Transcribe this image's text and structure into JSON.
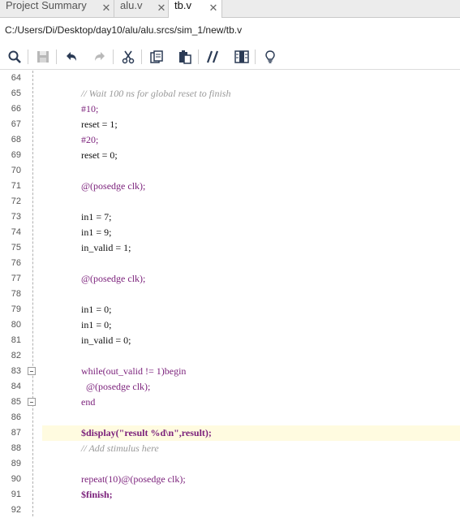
{
  "tabs": [
    {
      "label": "Project Summary",
      "active": false
    },
    {
      "label": "alu.v",
      "active": false
    },
    {
      "label": "tb.v",
      "active": true
    }
  ],
  "close_glyph": "✕",
  "file_path": "C:/Users/Di/Desktop/day10/alu/alu.srcs/sim_1/new/tb.v",
  "toolbar": {
    "icons": [
      "search-icon",
      "save-icon",
      "undo-icon",
      "redo-icon",
      "cut-icon",
      "copy-icon",
      "paste-icon",
      "comment-toggle-icon",
      "columns-icon",
      "lightbulb-icon"
    ]
  },
  "colors": {
    "keyword": "#7a1f7a",
    "comment": "#999999",
    "highlight": "#fffbe0"
  },
  "editor": {
    "highlighted_line": "87",
    "lines": [
      {
        "num": "64",
        "text": ""
      },
      {
        "num": "65",
        "text": "// Wait 100 ns for global reset to finish"
      },
      {
        "num": "66",
        "text": "#10;"
      },
      {
        "num": "67",
        "text": "reset = 1;"
      },
      {
        "num": "68",
        "text": "#20;"
      },
      {
        "num": "69",
        "text": "reset = 0;"
      },
      {
        "num": "70",
        "text": ""
      },
      {
        "num": "71",
        "text": "@(posedge clk);"
      },
      {
        "num": "72",
        "text": ""
      },
      {
        "num": "73",
        "text": "in1 = 7;"
      },
      {
        "num": "74",
        "text": "in1 = 9;"
      },
      {
        "num": "75",
        "text": "in_valid = 1;"
      },
      {
        "num": "76",
        "text": ""
      },
      {
        "num": "77",
        "text": "@(posedge clk);"
      },
      {
        "num": "78",
        "text": ""
      },
      {
        "num": "79",
        "text": "in1 = 0;"
      },
      {
        "num": "80",
        "text": "in1 = 0;"
      },
      {
        "num": "81",
        "text": "in_valid = 0;"
      },
      {
        "num": "82",
        "text": ""
      },
      {
        "num": "83",
        "text": "while(out_valid != 1)begin"
      },
      {
        "num": "84",
        "text": "  @(posedge clk);"
      },
      {
        "num": "85",
        "text": "end"
      },
      {
        "num": "86",
        "text": ""
      },
      {
        "num": "87",
        "text": "$display(\"result %d\\n\",result);"
      },
      {
        "num": "88",
        "text": "// Add stimulus here"
      },
      {
        "num": "89",
        "text": ""
      },
      {
        "num": "90",
        "text": "repeat(10)@(posedge clk);"
      },
      {
        "num": "91",
        "text": "$finish;"
      },
      {
        "num": "92",
        "text": ""
      }
    ]
  }
}
